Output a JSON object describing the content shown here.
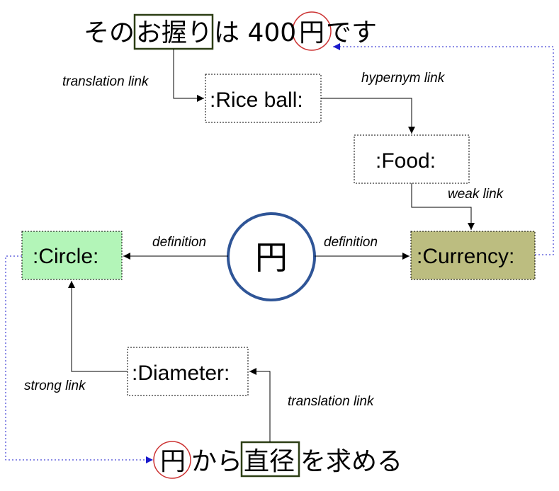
{
  "sentence_top": {
    "prefix": "その",
    "boxed_word": "お握り",
    "middle": "は 400",
    "circled_kanji": "円",
    "suffix": "です"
  },
  "sentence_bottom": {
    "circled_kanji": "円",
    "middle": "から",
    "boxed_word": "直径",
    "suffix": "を求める"
  },
  "nodes": {
    "rice_ball": ":Rice ball:",
    "food": ":Food:",
    "circle": ":Circle:",
    "currency": ":Currency:",
    "diameter": ":Diameter:",
    "center_kanji": "円"
  },
  "links": {
    "translation_top": "translation link",
    "hypernym": "hypernym link",
    "weak": "weak link",
    "definition_left": "definition",
    "definition_right": "definition",
    "strong": "strong link",
    "translation_bottom": "translation link"
  },
  "colors": {
    "circle_fill": "#b3f5b8",
    "currency_fill": "#bcbd80",
    "center_ring": "#2f5597",
    "kanji_circle": "#cc3333",
    "dashed_link": "#1a1acc",
    "box_border_dark": "#2c3e14"
  }
}
